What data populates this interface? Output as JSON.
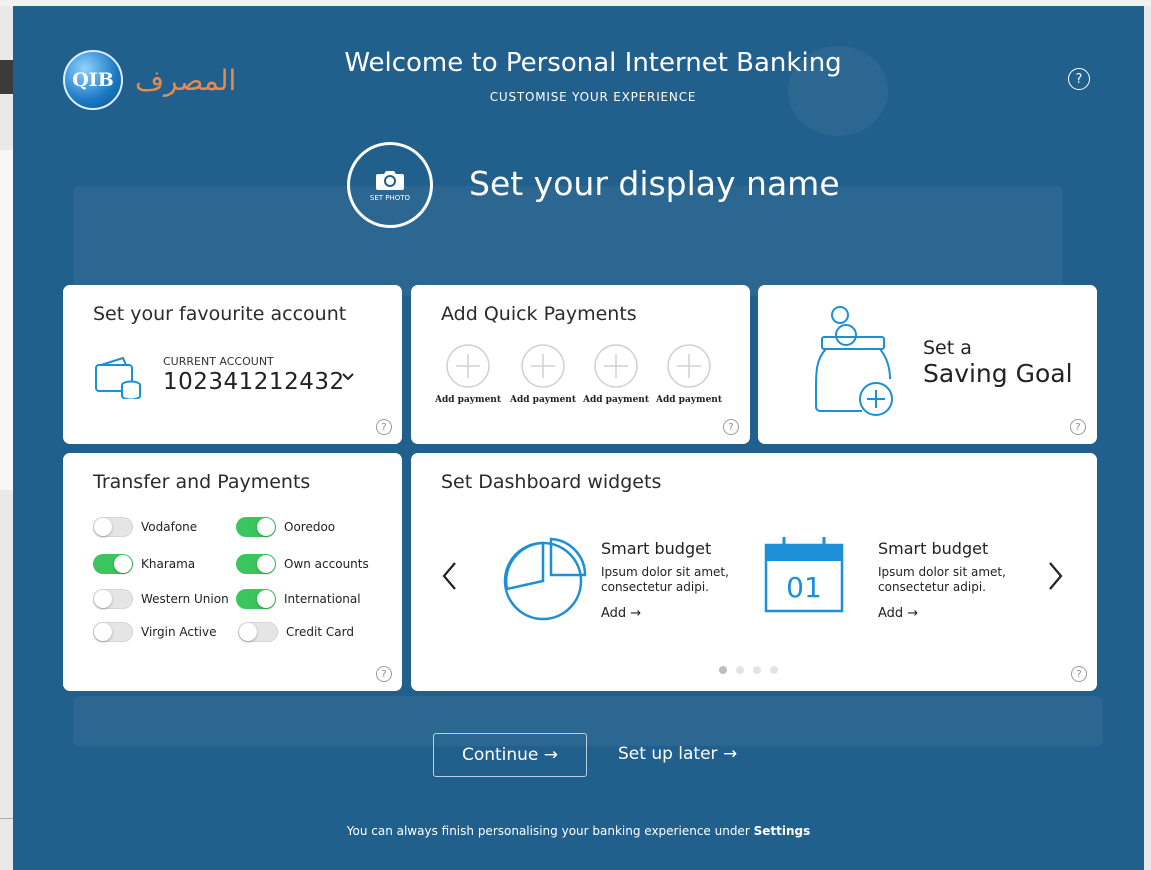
{
  "colors": {
    "brand_blue": "#215f8d",
    "accent_blue": "#1c8fd6",
    "toggle_on": "#3bc55f",
    "logo_orange": "#e88a4c"
  },
  "logo": {
    "mark_text": "QIB",
    "arabic_text": "المصرف",
    "icon": "qib-logo"
  },
  "header": {
    "title": "Welcome to Personal Internet Banking",
    "subtitle": "CUSTOMISE YOUR EXPERIENCE",
    "help_icon": "help-icon"
  },
  "profile": {
    "set_photo_label": "SET PHOTO",
    "display_name_title": "Set your display name",
    "photo_icon": "camera-icon"
  },
  "favourite_account": {
    "title": "Set your favourite account",
    "account_type": "CURRENT ACCOUNT",
    "account_number": "102341212432",
    "icon": "wallet-coins-icon"
  },
  "quick_payments": {
    "title": "Add Quick Payments",
    "items": [
      {
        "label": "Add payment"
      },
      {
        "label": "Add payment"
      },
      {
        "label": "Add payment"
      },
      {
        "label": "Add payment"
      }
    ]
  },
  "saving_goal": {
    "line1": "Set a",
    "line2": "Saving Goal",
    "icon": "jar-plus-icon"
  },
  "transfers": {
    "title": "Transfer and Payments",
    "left": [
      {
        "label": "Vodafone",
        "on": false
      },
      {
        "label": "Kharama",
        "on": true
      },
      {
        "label": "Western Union",
        "on": false
      },
      {
        "label": "Virgin Active",
        "on": false
      }
    ],
    "right": [
      {
        "label": "Ooredoo",
        "on": true
      },
      {
        "label": "Own accounts",
        "on": true
      },
      {
        "label": "International",
        "on": true
      },
      {
        "label": "Credit Card",
        "on": false
      }
    ]
  },
  "widgets": {
    "title": "Set Dashboard widgets",
    "items": [
      {
        "title": "Smart budget",
        "desc": "Ipsum dolor sit amet, consectetur adipi.",
        "add_label": "Add →",
        "icon": "pie-chart-icon"
      },
      {
        "title": "Smart budget",
        "desc": "Ipsum dolor sit amet, consectetur adipi.",
        "add_label": "Add →",
        "icon": "calendar-icon",
        "icon_text": "01"
      }
    ],
    "page_count": 4,
    "active_page": 1
  },
  "actions": {
    "continue_label": "Continue  →",
    "later_label": "Set up later  →"
  },
  "footer": {
    "text": "You can always finish personalising your banking experience under ",
    "link": "Settings"
  }
}
